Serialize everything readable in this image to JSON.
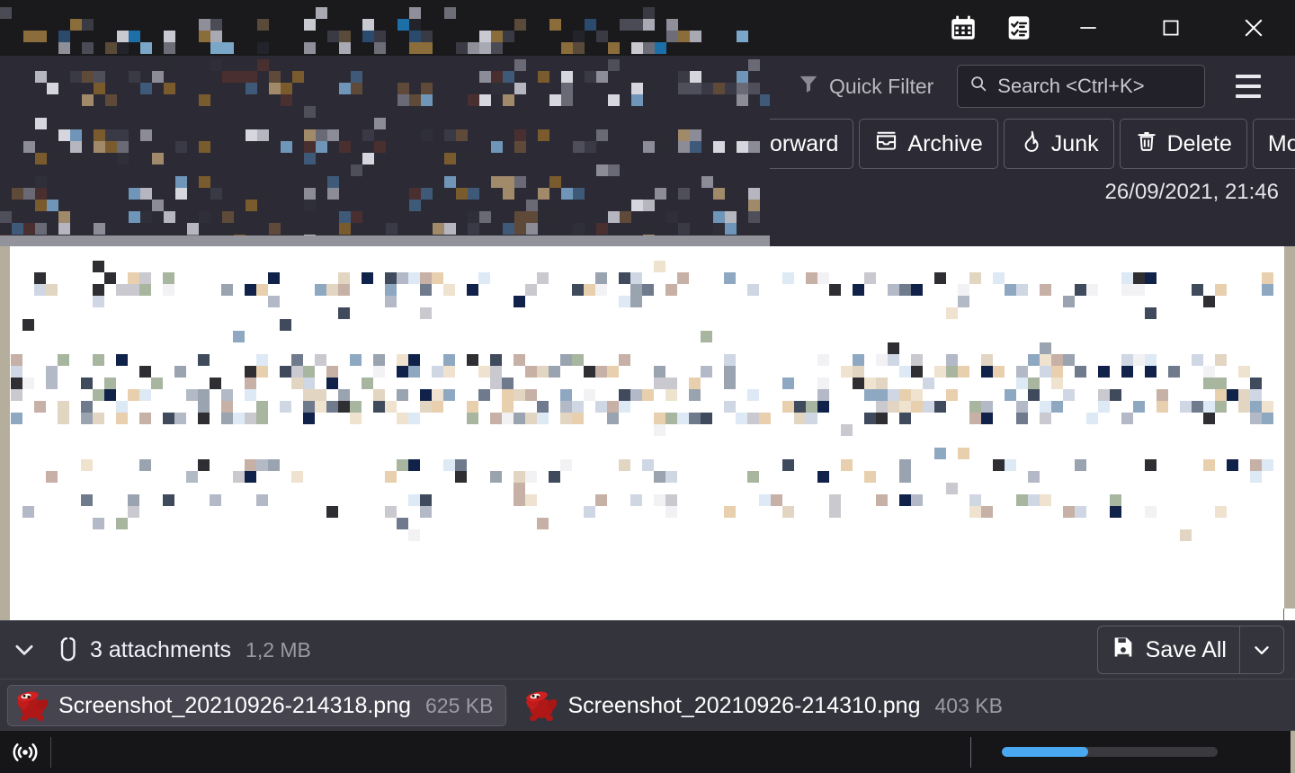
{
  "window": {
    "titlebar_buttons": [
      {
        "name": "calendar-icon",
        "label": "Calendar"
      },
      {
        "name": "tasks-icon",
        "label": "Tasks"
      },
      {
        "name": "minimize-icon",
        "label": "Minimize"
      },
      {
        "name": "maximize-icon",
        "label": "Maximize"
      },
      {
        "name": "close-icon",
        "label": "Close"
      }
    ]
  },
  "filterbar": {
    "quick_filter_label": "Quick Filter",
    "search_placeholder": "Search <Ctrl+K>",
    "search_value": "",
    "menu_label": "Application Menu"
  },
  "toolbar": {
    "forward_label": "orward",
    "archive_label": "Archive",
    "junk_label": "Junk",
    "delete_label": "Delete",
    "more_label": "More"
  },
  "message": {
    "date": "26/09/2021, 21:46"
  },
  "attachments": {
    "count_label": "3 attachments",
    "total_size": "1,2 MB",
    "save_all_label": "Save All",
    "items": [
      {
        "name": "Screenshot_20210926-214318.png",
        "size": "625 KB",
        "selected": true,
        "icon": "gimp-image-icon"
      },
      {
        "name": "Screenshot_20210926-214310.png",
        "size": "403 KB",
        "selected": false,
        "icon": "gimp-image-icon"
      }
    ]
  },
  "statusbar": {
    "activity_icon": "broadcast-icon",
    "progress_percent": 40
  },
  "colors": {
    "titlebar_bg": "#1a1a1d",
    "panel_bg": "#2c2b35",
    "attachbar_bg": "#34343d",
    "statusbar_bg": "#161619",
    "body_bg": "#ffffff",
    "accent_blue": "#4aa8f0",
    "tan_border": "#b6ae9c",
    "scrollbar": "#93939b",
    "text_primary": "#ffffff",
    "text_muted": "#9b9ba6"
  }
}
